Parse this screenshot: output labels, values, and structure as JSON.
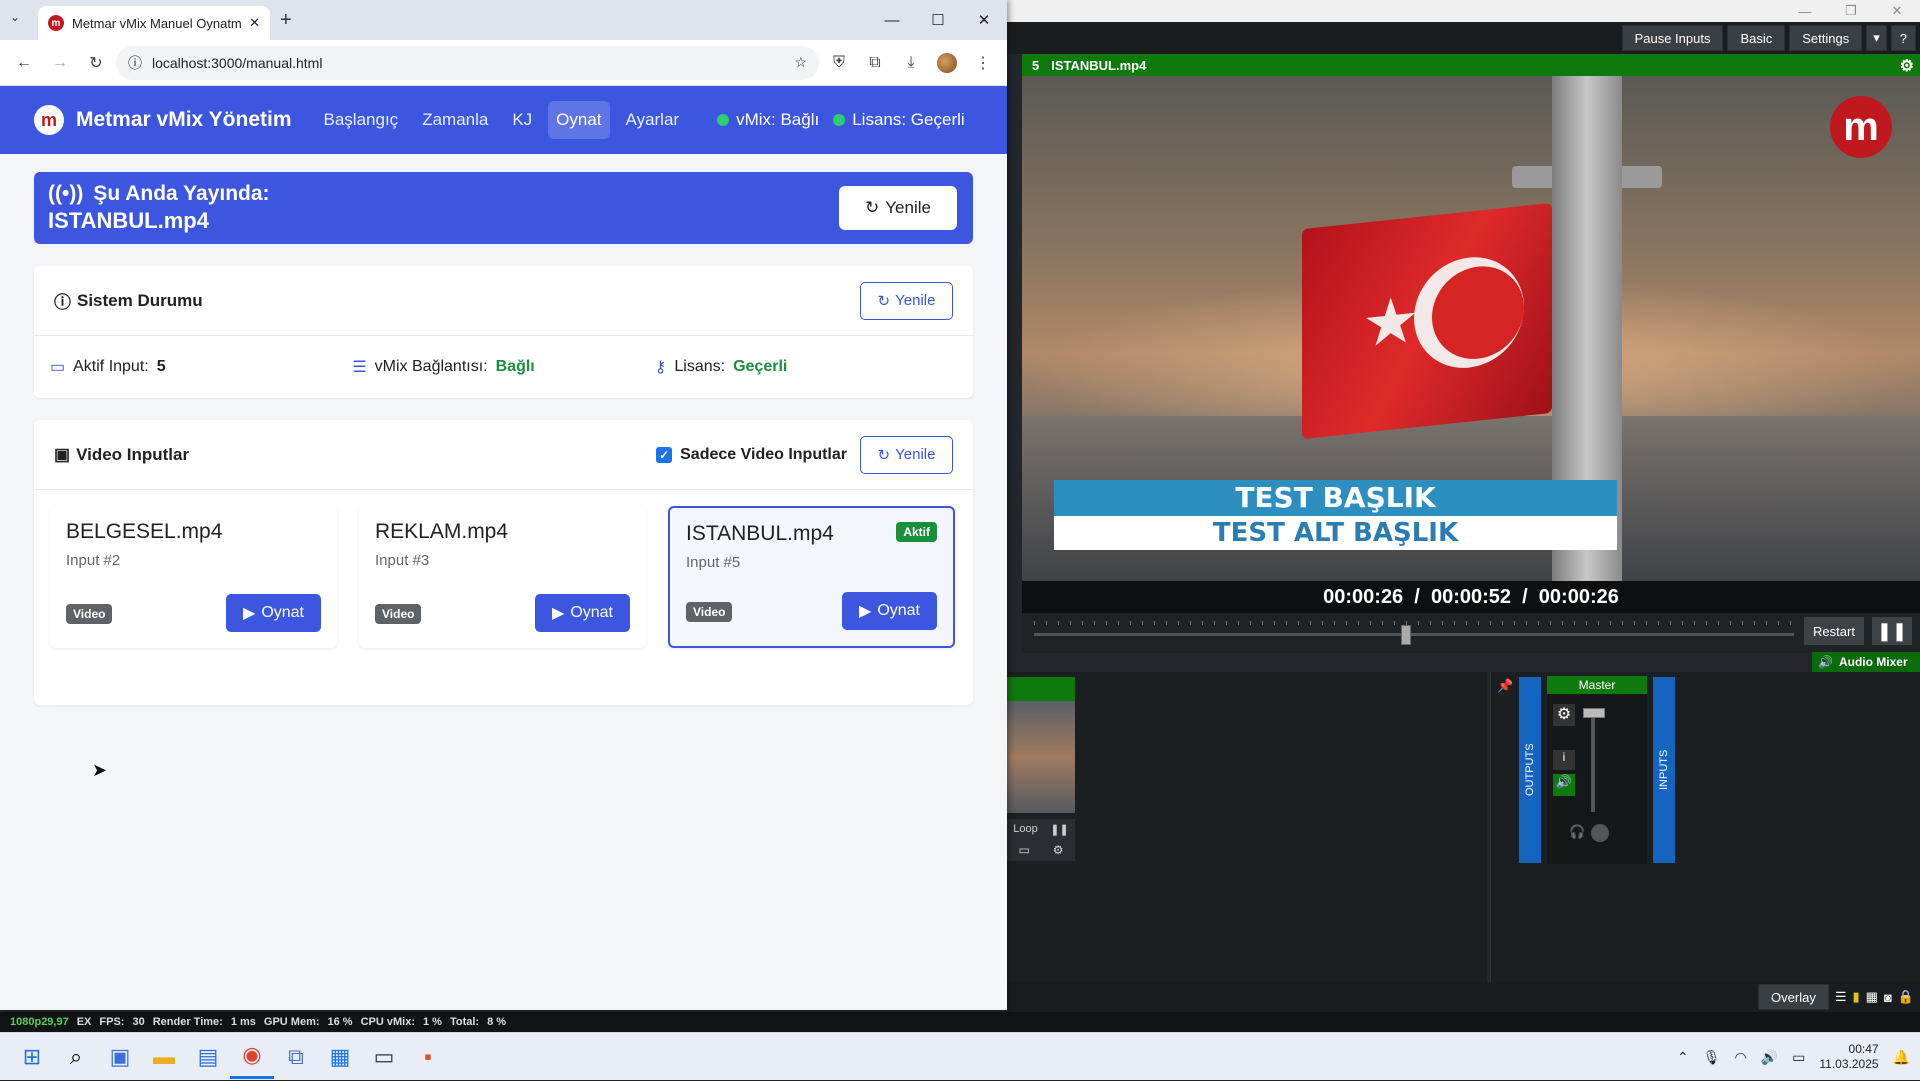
{
  "browser": {
    "tab_title": "Metmar vMix Manuel Oynatma",
    "url": "localhost:3000/manual.html"
  },
  "app": {
    "brand": "Metmar vMix Yönetim",
    "nav": [
      "Başlangıç",
      "Zamanla",
      "KJ",
      "Oynat",
      "Ayarlar"
    ],
    "active_nav": "Oynat",
    "vmix_status": "vMix: Bağlı",
    "license_status": "Lisans: Geçerli",
    "live": {
      "label": "Şu Anda Yayında:",
      "file": "ISTANBUL.mp4",
      "refresh": "Yenile"
    },
    "system": {
      "title": "Sistem Durumu",
      "refresh": "Yenile",
      "active_input_label": "Aktif Input:",
      "active_input_value": "5",
      "connection_label": "vMix Bağlantısı:",
      "connection_value": "Bağlı",
      "license_label": "Lisans:",
      "license_value": "Geçerli"
    },
    "videos": {
      "title": "Video Inputlar",
      "only_video_label": "Sadece Video Inputlar",
      "only_video_checked": true,
      "refresh": "Yenile",
      "items": [
        {
          "name": "BELGESEL.mp4",
          "input": "Input #2",
          "type": "Video",
          "play": "Oynat",
          "active": false
        },
        {
          "name": "REKLAM.mp4",
          "input": "Input #3",
          "type": "Video",
          "play": "Oynat",
          "active": false
        },
        {
          "name": "ISTANBUL.mp4",
          "input": "Input #5",
          "type": "Video",
          "play": "Oynat",
          "active": true,
          "badge": "Aktif"
        }
      ]
    }
  },
  "vmix": {
    "buttons": {
      "pause_inputs": "Pause Inputs",
      "basic": "Basic",
      "settings": "Settings",
      "help": "?"
    },
    "preview_number": "5",
    "preview_title": "ISTANBUL.mp4",
    "lower_third_title": "TEST BAŞLIK",
    "lower_third_sub": "TEST ALT BAŞLIK",
    "timecode": "00:00:26  /  00:00:52  /  00:00:26",
    "scrub_position": 0.5,
    "restart": "Restart",
    "audio_mixer": "Audio Mixer",
    "loop": "Loop",
    "master": "Master",
    "outputs": "OUTPUTS",
    "inputs": "INPUTS",
    "overlay": "Overlay",
    "status": {
      "resolution": "1080p29,97",
      "ex": "EX",
      "fps_label": "FPS:",
      "fps": "30",
      "render_label": "Render Time:",
      "render": "1 ms",
      "gpu_label": "GPU Mem:",
      "gpu": "16 %",
      "cpu_label": "CPU vMix:",
      "cpu": "1 %",
      "total_label": "Total:",
      "total": "8 %"
    }
  },
  "taskbar": {
    "time": "00:47",
    "date": "11.03.2025"
  }
}
